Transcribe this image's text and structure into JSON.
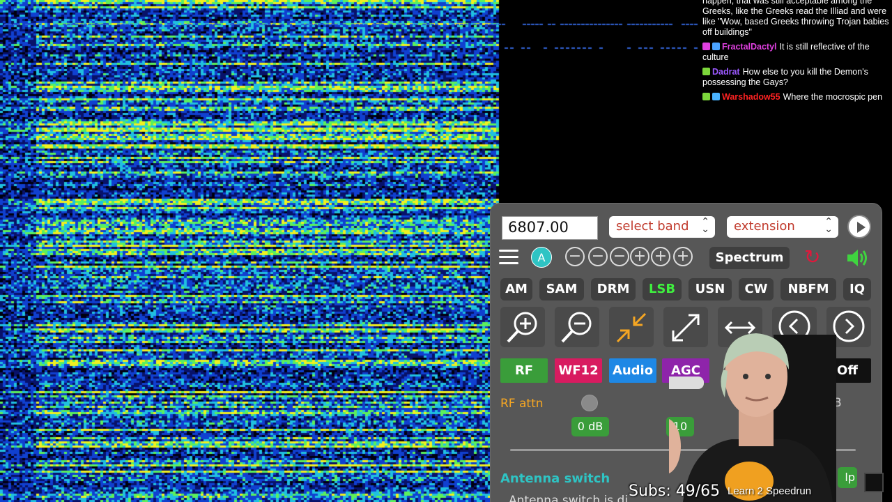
{
  "chat": {
    "messages": [
      {
        "user": "",
        "text": "happen, that was still acceptable among the Greeks, like the Greeks read the Illiad and were like \"Wow, based Greeks throwing Trojan babies off buildings\"",
        "color": "#ffffff",
        "badges": []
      },
      {
        "user": "FractalDactyl",
        "text": "It is still reflective of the culture",
        "color": "#e040e0",
        "badges": [
          "#e040e0",
          "#4aa3ff"
        ]
      },
      {
        "user": "Dadrat",
        "text": "How else to you kill the Demon's possessing the Gays?",
        "color": "#9b59ff",
        "badges": [
          "#7cd63b"
        ]
      },
      {
        "user": "Warshadow55",
        "text": "Where the mocrospic pen",
        "color": "#ff2222",
        "badges": [
          "#7cd63b",
          "#4ab3ff"
        ]
      }
    ]
  },
  "panel": {
    "frequency": "6807.00",
    "band_select": "select band",
    "extension_select": "extension",
    "a_button": "A",
    "zoom_buttons": [
      "−",
      "−",
      "−",
      "+",
      "+",
      "+"
    ],
    "spectrum_label": "Spectrum",
    "modes": [
      "AM",
      "SAM",
      "DRM",
      "LSB",
      "USN",
      "CW",
      "NBFM",
      "IQ"
    ],
    "active_mode": "LSB",
    "tabs": [
      {
        "label": "RF",
        "bg": "#3a9d3a"
      },
      {
        "label": "WF12",
        "bg": "#d81b60"
      },
      {
        "label": "Audio",
        "bg": "#1e88e5"
      },
      {
        "label": "AGC",
        "bg": "#8e24aa"
      },
      {
        "label": "Off",
        "bg": "#111111"
      }
    ],
    "rf_attn_label": "RF attn",
    "attn_value_partial": "B",
    "db_buttons": [
      "0 dB",
      "10"
    ],
    "antenna_title": "Antenna switch",
    "antenna_text": "Antenna switch is di",
    "help_label": "lp"
  },
  "overlay": {
    "subs": "Subs: 49/65",
    "speedrun": "Learn 2 Speedrun"
  },
  "colors": {
    "accent_teal": "#2ec4c4",
    "active_green": "#3ff03f",
    "panel_bg": "#575757"
  }
}
